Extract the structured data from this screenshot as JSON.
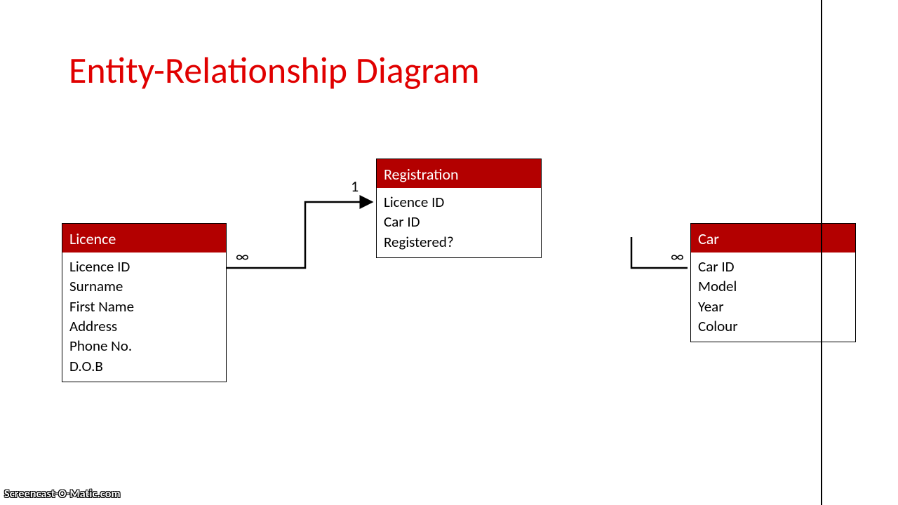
{
  "title": "Entity-Relationship Diagram",
  "entities": {
    "licence": {
      "name": "Licence",
      "attrs": [
        "Licence ID",
        "Surname",
        "First Name",
        "Address",
        "Phone No.",
        "D.O.B"
      ]
    },
    "registration": {
      "name": "Registration",
      "attrs": [
        "Licence ID",
        "Car ID",
        "Registered?"
      ]
    },
    "car": {
      "name": "Car",
      "attrs": [
        "Car ID",
        "Model",
        "Year",
        "Colour"
      ]
    }
  },
  "cardinality": {
    "inf_left": "∞",
    "one": "1",
    "inf_right": "∞"
  },
  "watermark": "Screencast-O-Matic.com"
}
